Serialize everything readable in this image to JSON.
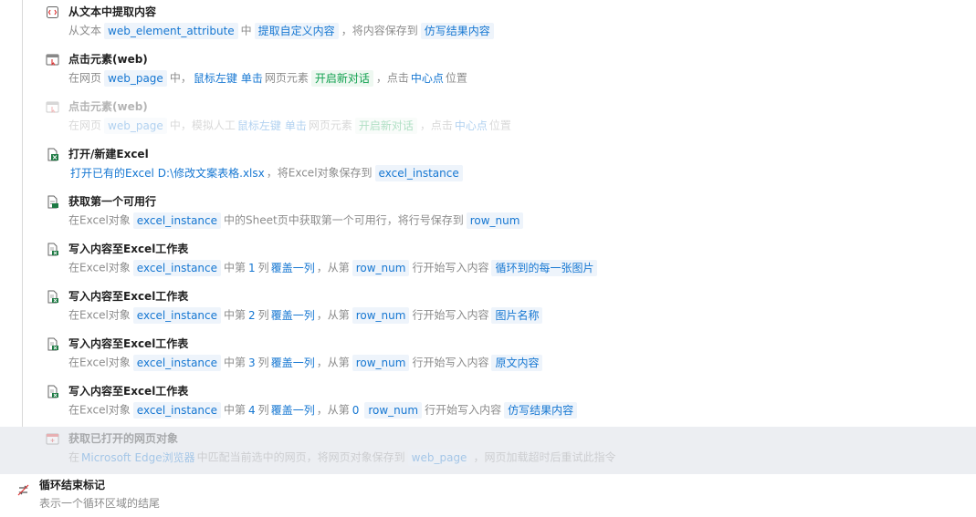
{
  "steps": [
    {
      "title": "从文本中提取内容",
      "icon": "text-extract-icon",
      "parts": [
        {
          "k": "t",
          "v": "从文本"
        },
        {
          "k": "chip",
          "v": "web_element_attribute"
        },
        {
          "k": "t",
          "v": "中"
        },
        {
          "k": "chip",
          "v": "提取自定义内容"
        },
        {
          "k": "t",
          "v": "，将内容保存到"
        },
        {
          "k": "chip",
          "v": "仿写结果内容"
        }
      ]
    },
    {
      "title": "点击元素(web)",
      "icon": "click-element-icon",
      "parts": [
        {
          "k": "t",
          "v": "在网页"
        },
        {
          "k": "chip",
          "v": "web_page"
        },
        {
          "k": "t",
          "v": "中，"
        },
        {
          "k": "lk",
          "v": "鼠标左键"
        },
        {
          "k": "lk",
          "v": "单击"
        },
        {
          "k": "t",
          "v": "网页元素"
        },
        {
          "k": "chip green",
          "v": "开启新对话"
        },
        {
          "k": "t",
          "v": "，点击"
        },
        {
          "k": "lk",
          "v": "中心点"
        },
        {
          "k": "t",
          "v": "位置"
        }
      ]
    },
    {
      "title": "点击元素(web)",
      "icon": "click-element-icon",
      "disabled": true,
      "parts": [
        {
          "k": "t",
          "v": "在网页"
        },
        {
          "k": "chip",
          "v": "web_page"
        },
        {
          "k": "t",
          "v": "中，模拟人工"
        },
        {
          "k": "lk",
          "v": "鼠标左键"
        },
        {
          "k": "lk",
          "v": "单击"
        },
        {
          "k": "t",
          "v": "网页元素"
        },
        {
          "k": "chip green",
          "v": "开启新对话"
        },
        {
          "k": "t",
          "v": "，点击"
        },
        {
          "k": "lk",
          "v": "中心点"
        },
        {
          "k": "t",
          "v": "位置"
        }
      ]
    },
    {
      "title": "打开/新建Excel",
      "icon": "excel-file-icon",
      "parts": [
        {
          "k": "lk",
          "v": "打开已有的Excel"
        },
        {
          "k": "lk",
          "v": "D:\\修改文案表格.xlsx"
        },
        {
          "k": "t",
          "v": "，将Excel对象保存到"
        },
        {
          "k": "chip",
          "v": "excel_instance"
        }
      ]
    },
    {
      "title": "获取第一个可用行",
      "icon": "excel-row-icon",
      "parts": [
        {
          "k": "t",
          "v": "在Excel对象"
        },
        {
          "k": "chip",
          "v": "excel_instance"
        },
        {
          "k": "t",
          "v": "中的Sheet页"
        },
        {
          "k": "t",
          "v": "中获取第一个可用行，将行号保存到"
        },
        {
          "k": "chip",
          "v": "row_num"
        }
      ]
    },
    {
      "title": "写入内容至Excel工作表",
      "icon": "excel-write-icon",
      "parts": [
        {
          "k": "t",
          "v": "在Excel对象"
        },
        {
          "k": "chip",
          "v": "excel_instance"
        },
        {
          "k": "t",
          "v": "中第"
        },
        {
          "k": "num",
          "v": "1"
        },
        {
          "k": "t",
          "v": "列"
        },
        {
          "k": "lk",
          "v": "覆盖一列"
        },
        {
          "k": "t",
          "v": "，从第"
        },
        {
          "k": "chip",
          "v": "row_num"
        },
        {
          "k": "t",
          "v": "行开始写入内容"
        },
        {
          "k": "chip",
          "v": "循环到的每一张图片"
        }
      ]
    },
    {
      "title": "写入内容至Excel工作表",
      "icon": "excel-write-icon",
      "parts": [
        {
          "k": "t",
          "v": "在Excel对象"
        },
        {
          "k": "chip",
          "v": "excel_instance"
        },
        {
          "k": "t",
          "v": "中第"
        },
        {
          "k": "num",
          "v": "2"
        },
        {
          "k": "t",
          "v": "列"
        },
        {
          "k": "lk",
          "v": "覆盖一列"
        },
        {
          "k": "t",
          "v": "，从第"
        },
        {
          "k": "chip",
          "v": "row_num"
        },
        {
          "k": "t",
          "v": "行开始写入内容"
        },
        {
          "k": "chip",
          "v": "图片名称"
        }
      ]
    },
    {
      "title": "写入内容至Excel工作表",
      "icon": "excel-write-icon",
      "parts": [
        {
          "k": "t",
          "v": "在Excel对象"
        },
        {
          "k": "chip",
          "v": "excel_instance"
        },
        {
          "k": "t",
          "v": "中第"
        },
        {
          "k": "num",
          "v": "3"
        },
        {
          "k": "t",
          "v": "列"
        },
        {
          "k": "lk",
          "v": "覆盖一列"
        },
        {
          "k": "t",
          "v": "，从第"
        },
        {
          "k": "chip",
          "v": "row_num"
        },
        {
          "k": "t",
          "v": "行开始写入内容"
        },
        {
          "k": "chip",
          "v": "原文内容"
        }
      ]
    },
    {
      "title": "写入内容至Excel工作表",
      "icon": "excel-write-icon",
      "parts": [
        {
          "k": "t",
          "v": "在Excel对象"
        },
        {
          "k": "chip",
          "v": "excel_instance"
        },
        {
          "k": "t",
          "v": "中第"
        },
        {
          "k": "num",
          "v": "4"
        },
        {
          "k": "t",
          "v": "列"
        },
        {
          "k": "lk",
          "v": "覆盖一列"
        },
        {
          "k": "t",
          "v": "，从第"
        },
        {
          "k": "num",
          "v": "0"
        },
        {
          "k": "chip",
          "v": "row_num"
        },
        {
          "k": "t",
          "v": "行开始写入内容"
        },
        {
          "k": "chip",
          "v": "仿写结果内容"
        }
      ]
    },
    {
      "title": "获取已打开的网页对象",
      "icon": "web-page-icon",
      "disabled": true,
      "selected": true,
      "parts": [
        {
          "k": "t",
          "v": "在"
        },
        {
          "k": "lk",
          "v": "Microsoft Edge浏览器"
        },
        {
          "k": "t",
          "v": "中匹配当前选中的网页，将网页对象保存到"
        },
        {
          "k": "chip",
          "v": "web_page"
        },
        {
          "k": "t",
          "v": "，网页加载超时后重试此指令"
        }
      ]
    }
  ],
  "loop_end": {
    "title": "循环结束标记",
    "desc": "表示一个循环区域的结尾",
    "icon": "loop-end-icon"
  },
  "colors": {
    "link": "#1677d2",
    "chip_bg": "#eef4fb",
    "green": "#12a150",
    "title": "#1f1f1f",
    "muted": "#8c8c8c",
    "selected_bg": "#eceef2"
  }
}
